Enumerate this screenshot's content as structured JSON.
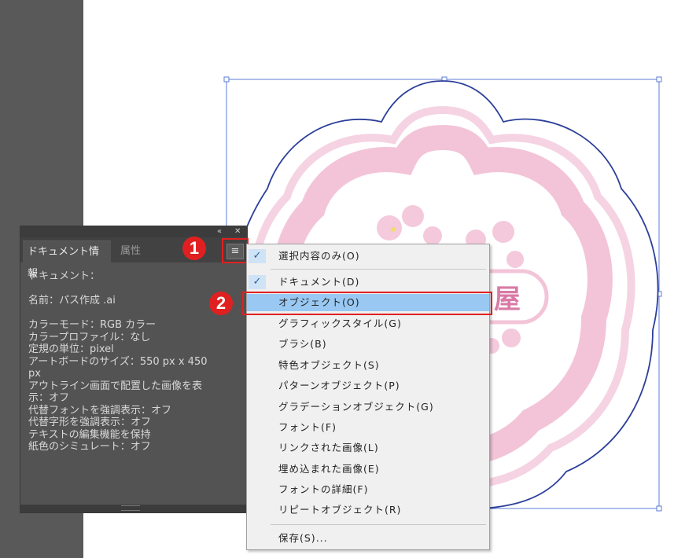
{
  "panel": {
    "collapse_icon": "«",
    "close_icon": "✕",
    "tabs": [
      "ドキュメント情報",
      "属性"
    ],
    "menu_icon": "≡",
    "lines": [
      "ドキュメント：",
      "",
      "名前：パス作成 .ai",
      "",
      "カラーモード：RGB カラー",
      "カラープロファイル：なし",
      "定規の単位：pixel",
      "アートボードのサイズ：550 px x 450",
      "px",
      "アウトライン画面で配置した画像を表",
      "示：オフ",
      "代替フォントを強調表示：オフ",
      "代替字形を強調表示：オフ",
      "テキストの編集機能を保持",
      "紙色のシミュレート：オフ"
    ]
  },
  "menu": {
    "items": [
      {
        "label": "選択内容のみ(O)",
        "checked": true
      },
      {
        "label": "ドキュメント(D)",
        "checked": true
      },
      {
        "label": "オブジェクト(O)",
        "highlighted": true
      },
      {
        "label": "グラフィックスタイル(G)"
      },
      {
        "label": "ブラシ(B)"
      },
      {
        "label": "特色オブジェクト(S)"
      },
      {
        "label": "パターンオブジェクト(P)"
      },
      {
        "label": "グラデーションオブジェクト(G)"
      },
      {
        "label": "フォント(F)"
      },
      {
        "label": "リンクされた画像(L)"
      },
      {
        "label": "埋め込まれた画像(E)"
      },
      {
        "label": "フォントの詳細(F)"
      },
      {
        "label": "リピートオブジェクト(R)"
      },
      {
        "label": "保存(S)..."
      }
    ],
    "check_icon": "✓"
  },
  "callouts": {
    "one": "1",
    "two": "2"
  },
  "artwork": {
    "visible_char": "屋"
  },
  "colors": {
    "pink": "#f3c4d8",
    "highlight": "#99c9f3",
    "callout_red": "#e02020",
    "selection_blue": "#3355cc"
  }
}
